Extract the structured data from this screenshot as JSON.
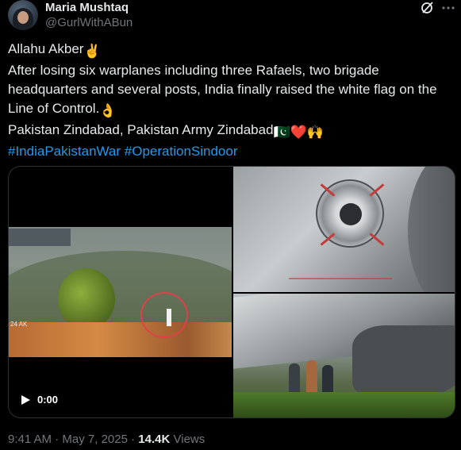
{
  "author": {
    "name": "Maria Mushtaq",
    "handle": "@GurlWithABun"
  },
  "tweet": {
    "line1": "Allahu Akber",
    "line1_emoji": "✌️",
    "body": "After losing six warplanes including three Rafaels, two brigade headquarters and several posts, India finally raised the white flag on the Line of Control.",
    "body_emoji": "👌",
    "line3": " Pakistan Zindabad, Pakistan Army Zindabad",
    "line3_emojis": "🇵🇰❤️🙌",
    "hashtag1": "#IndiaPakistanWar",
    "hashtag2": "#OperationSindoor"
  },
  "media": {
    "video_time": "0:00",
    "video_overlay_text": "24 AK"
  },
  "meta": {
    "time": "9:41 AM",
    "separator": "·",
    "date": "May 7, 2025",
    "views_count": "14.4K",
    "views_label": "Views"
  },
  "icons": {
    "grok": "grok-icon",
    "more": "more-icon",
    "play": "play-icon"
  },
  "colors": {
    "background": "#000000",
    "text": "#e7e9ea",
    "secondary": "#71767b",
    "link": "#1d9bf0"
  }
}
